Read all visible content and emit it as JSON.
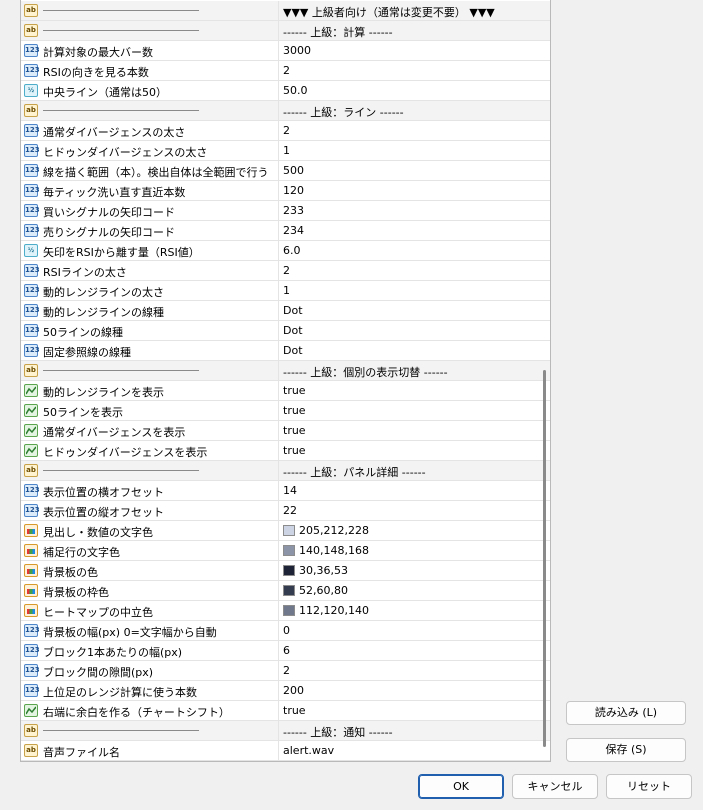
{
  "rows": [
    {
      "kind": "sep",
      "icon": "ab",
      "value": "▼▼▼ 上級者向け（通常は変更不要） ▼▼▼"
    },
    {
      "kind": "sep",
      "icon": "ab",
      "value": "------ 上級：計算 ------"
    },
    {
      "icon": "123",
      "name": "計算対象の最大バー数",
      "value": "3000"
    },
    {
      "icon": "123",
      "name": "RSIの向きを見る本数",
      "value": "2"
    },
    {
      "icon": "1/2",
      "name": "中央ライン（通常は50）",
      "value": "50.0"
    },
    {
      "kind": "sep",
      "icon": "ab",
      "value": "------ 上級：ライン ------"
    },
    {
      "icon": "123",
      "name": "通常ダイバージェンスの太さ",
      "value": "2"
    },
    {
      "icon": "123",
      "name": "ヒドゥンダイバージェンスの太さ",
      "value": "1"
    },
    {
      "icon": "123",
      "name": "線を描く範囲（本）。検出自体は全範囲で行う",
      "value": "500"
    },
    {
      "icon": "123",
      "name": "毎ティック洗い直す直近本数",
      "value": "120"
    },
    {
      "icon": "123",
      "name": "買いシグナルの矢印コード",
      "value": "233"
    },
    {
      "icon": "123",
      "name": "売りシグナルの矢印コード",
      "value": "234"
    },
    {
      "icon": "1/2",
      "name": "矢印をRSIから離す量（RSI値）",
      "value": "6.0"
    },
    {
      "icon": "123",
      "name": "RSIラインの太さ",
      "value": "2"
    },
    {
      "icon": "123",
      "name": "動的レンジラインの太さ",
      "value": "1"
    },
    {
      "icon": "123",
      "name": "動的レンジラインの線種",
      "value": "Dot"
    },
    {
      "icon": "123",
      "name": "50ラインの線種",
      "value": "Dot"
    },
    {
      "icon": "123",
      "name": "固定参照線の線種",
      "value": "Dot"
    },
    {
      "kind": "sep",
      "icon": "ab",
      "value": "------ 上級：個別の表示切替 ------"
    },
    {
      "icon": "bool",
      "name": "動的レンジラインを表示",
      "value": "true"
    },
    {
      "icon": "bool",
      "name": "50ラインを表示",
      "value": "true"
    },
    {
      "icon": "bool",
      "name": "通常ダイバージェンスを表示",
      "value": "true"
    },
    {
      "icon": "bool",
      "name": "ヒドゥンダイバージェンスを表示",
      "value": "true"
    },
    {
      "kind": "sep",
      "icon": "ab",
      "value": "------ 上級：パネル詳細 ------"
    },
    {
      "icon": "123",
      "name": "表示位置の横オフセット",
      "value": "14"
    },
    {
      "icon": "123",
      "name": "表示位置の縦オフセット",
      "value": "22"
    },
    {
      "icon": "color",
      "name": "見出し・数値の文字色",
      "value": "205,212,228",
      "color": "#cdd4e4"
    },
    {
      "icon": "color",
      "name": "補足行の文字色",
      "value": "140,148,168",
      "color": "#8c94a8"
    },
    {
      "icon": "color",
      "name": "背景板の色",
      "value": "30,36,53",
      "color": "#1e2435"
    },
    {
      "icon": "color",
      "name": "背景板の枠色",
      "value": "52,60,80",
      "color": "#343c50"
    },
    {
      "icon": "color",
      "name": "ヒートマップの中立色",
      "value": "112,120,140",
      "color": "#70788c"
    },
    {
      "icon": "123",
      "name": "背景板の幅(px) 0=文字幅から自動",
      "value": "0"
    },
    {
      "icon": "123",
      "name": "ブロック1本あたりの幅(px)",
      "value": "6"
    },
    {
      "icon": "123",
      "name": "ブロック間の隙間(px)",
      "value": "2"
    },
    {
      "icon": "123",
      "name": "上位足のレンジ計算に使う本数",
      "value": "200"
    },
    {
      "icon": "bool",
      "name": "右端に余白を作る（チャートシフト）",
      "value": "true"
    },
    {
      "kind": "sep",
      "icon": "ab",
      "value": "------ 上級：通知 ------"
    },
    {
      "icon": "ab",
      "name": "音声ファイル名",
      "value": "alert.wav"
    }
  ],
  "buttons": {
    "load": "読み込み (L)",
    "save": "保存 (S)",
    "ok": "OK",
    "cancel": "キャンセル",
    "reset": "リセット"
  }
}
